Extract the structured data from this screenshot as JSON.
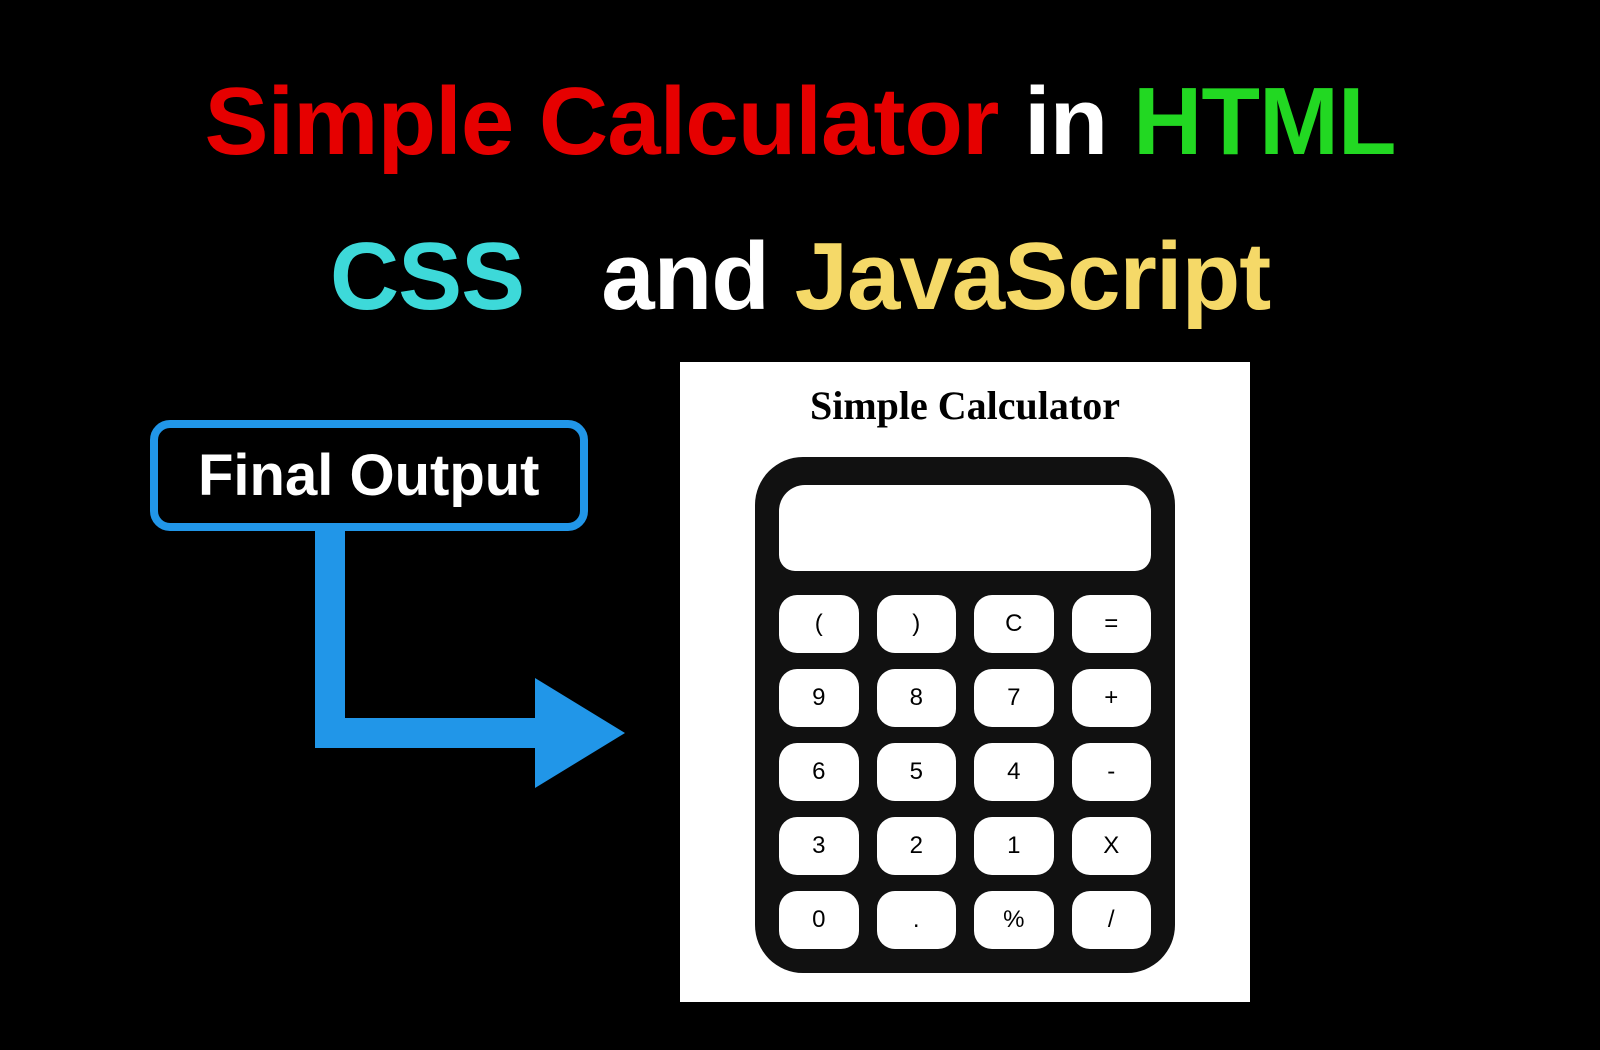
{
  "title": {
    "line1": {
      "part1": "Simple Calculator",
      "part2": "in",
      "part3": "HTML"
    },
    "line2": {
      "part1": "CSS",
      "part2": "and",
      "part3": "JavaScript"
    }
  },
  "finalOutput": {
    "label": "Final Output"
  },
  "calculator": {
    "heading": "Simple Calculator",
    "displayValue": "",
    "buttons": [
      "(",
      ")",
      "C",
      "=",
      "9",
      "8",
      "7",
      "+",
      "6",
      "5",
      "4",
      "-",
      "3",
      "2",
      "1",
      "X",
      "0",
      ".",
      "%",
      "/"
    ]
  },
  "colors": {
    "background": "#000000",
    "red": "#e60000",
    "white": "#ffffff",
    "green": "#22d822",
    "cyan": "#3dd9d9",
    "gold": "#f5d968",
    "arrow": "#2196e8",
    "calcBody": "#111111",
    "panel": "#ffffff"
  }
}
